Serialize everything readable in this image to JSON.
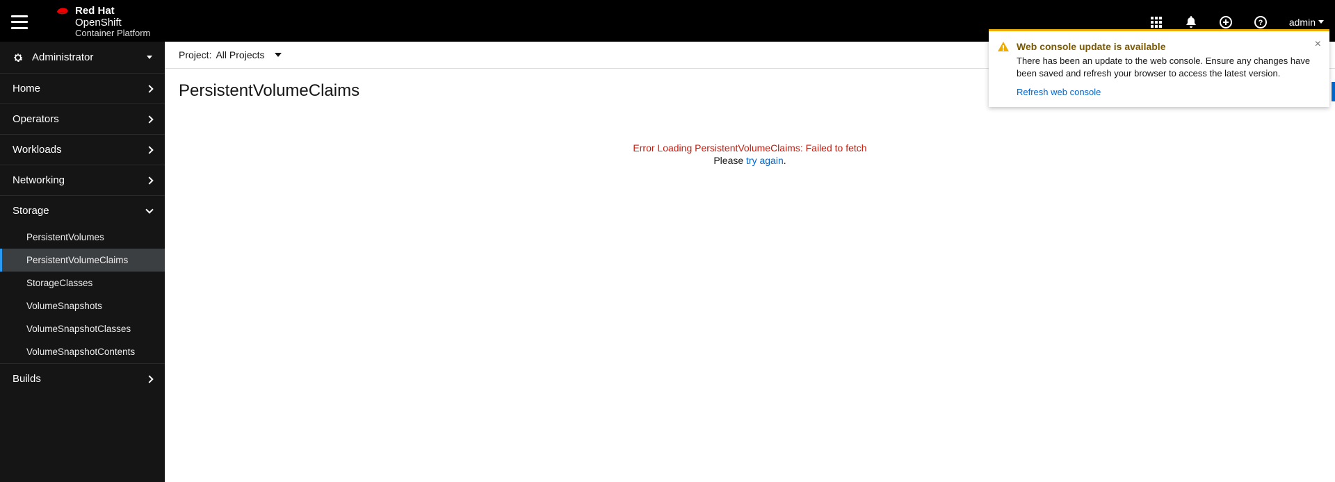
{
  "brand": {
    "line1": "Red Hat",
    "line2": "OpenShift",
    "line3": "Container Platform"
  },
  "user": {
    "name": "admin"
  },
  "perspective": {
    "label": "Administrator"
  },
  "nav": {
    "home": "Home",
    "operators": "Operators",
    "workloads": "Workloads",
    "networking": "Networking",
    "storage": "Storage",
    "builds": "Builds",
    "storage_items": {
      "pv": "PersistentVolumes",
      "pvc": "PersistentVolumeClaims",
      "sc": "StorageClasses",
      "vs": "VolumeSnapshots",
      "vsc": "VolumeSnapshotClasses",
      "vscn": "VolumeSnapshotContents"
    }
  },
  "projectbar": {
    "label": "Project:",
    "current": "All Projects"
  },
  "page": {
    "title": "PersistentVolumeClaims"
  },
  "error": {
    "message": "Error Loading PersistentVolumeClaims: Failed to fetch",
    "prefix": "Please ",
    "link": "try again",
    "suffix": "."
  },
  "toast": {
    "title": "Web console update is available",
    "msg": "There has been an update to the web console. Ensure any changes have been saved and refresh your browser to access the latest version.",
    "link": "Refresh web console"
  }
}
